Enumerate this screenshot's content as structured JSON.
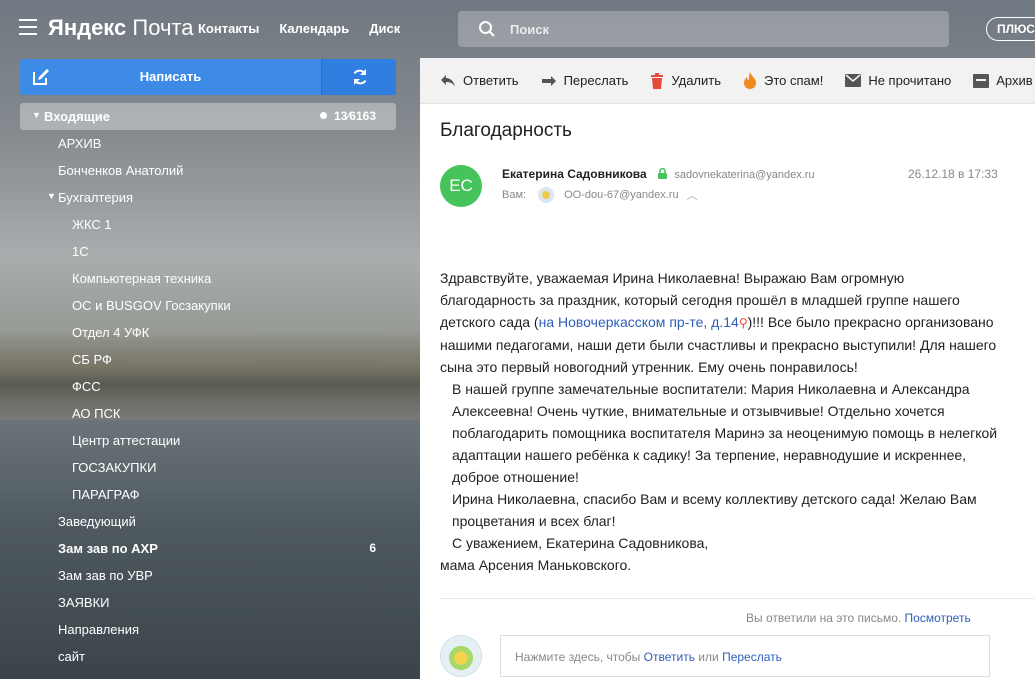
{
  "header": {
    "logo_bold": "Яндекс",
    "logo_thin": "Почта",
    "nav": [
      "Контакты",
      "Календарь",
      "Диск"
    ],
    "search_placeholder": "Поиск",
    "plus_label": "ПЛЮС"
  },
  "compose": {
    "label": "Написать"
  },
  "folders": {
    "inbox": {
      "name": "Входящие",
      "count": "13⁄6163"
    },
    "items": [
      {
        "name": "АРХИВ",
        "level": 1
      },
      {
        "name": "Бонченков Анатолий",
        "level": 1
      },
      {
        "name": "Бухгалтерия",
        "level": 1,
        "expanded": true
      },
      {
        "name": "ЖКС 1",
        "level": 2
      },
      {
        "name": "1С",
        "level": 2
      },
      {
        "name": "Компьютерная техника",
        "level": 2
      },
      {
        "name": "ОС и BUSGOV Госзакупки",
        "level": 2
      },
      {
        "name": "Отдел 4 УФК",
        "level": 2
      },
      {
        "name": "СБ РФ",
        "level": 2
      },
      {
        "name": "ФСС",
        "level": 2
      },
      {
        "name": "АО ПСК",
        "level": 2
      },
      {
        "name": "Центр аттестации",
        "level": 2
      },
      {
        "name": "ГОСЗАКУПКИ",
        "level": 2
      },
      {
        "name": "ПАРАГРАФ",
        "level": 2
      },
      {
        "name": "Заведующий",
        "level": 1
      },
      {
        "name": "Зам зав по АХР",
        "level": 1,
        "bold": true,
        "count": "6"
      },
      {
        "name": "Зам зав по УВР",
        "level": 1
      },
      {
        "name": "ЗАЯВКИ",
        "level": 1
      },
      {
        "name": "Направления",
        "level": 1
      },
      {
        "name": "сайт",
        "level": 1
      }
    ]
  },
  "toolbar": {
    "reply": "Ответить",
    "forward": "Переслать",
    "delete": "Удалить",
    "spam": "Это спам!",
    "unread": "Не прочитано",
    "archive": "Архив"
  },
  "message": {
    "subject": "Благодарность",
    "avatar_initials": "ЕС",
    "avatar_color": "#46c35a",
    "sender_name": "Екатерина Садовникова",
    "sender_email": "sadovnekaterina@yandex.ru",
    "date": "26.12.18 в 17:33",
    "to_label": "Вам:",
    "to_email": "OO-dou-67@yandex.ru",
    "body": {
      "p1_a": "Здравствуйте, уважаемая Ирина Николаевна! Выражаю Вам огромную благодарность за праздник, который сегодня прошёл в младшей группе нашего детского сада (",
      "p1_link": "на Новочеркасском пр-те, д.14",
      "p1_b": ")!!! Все было прекрасно организовано нашими педагогами, наши дети были счастливы и прекрасно выступили! Для нашего сына это первый новогодний утренник. Ему очень понравилось!",
      "p2": "В нашей группе замечательные воспитатели: Мария Николаевна и Александра Алексеевна! Очень чуткие, внимательные и отзывчивые! Отдельно хочется поблагодарить помощника воспитателя Маринэ за неоценимую помощь в нелегкой адаптации нашего ребёнка к садику! За терпение, неравнодушие и искреннее, доброе отношение!",
      "p3": "Ирина Николаевна, спасибо Вам и всему коллективу детского сада! Желаю Вам процветания и всех благ!",
      "p4": "С уважением, Екатерина Садовникова,",
      "p5": "мама Арсения Маньковского."
    },
    "replied_text": "Вы ответили на это письмо.",
    "replied_link": "Посмотреть",
    "reply_prompt": "Нажмите здесь, чтобы",
    "reply_link": "Ответить",
    "or_text": "или",
    "forward_link": "Переслать"
  }
}
